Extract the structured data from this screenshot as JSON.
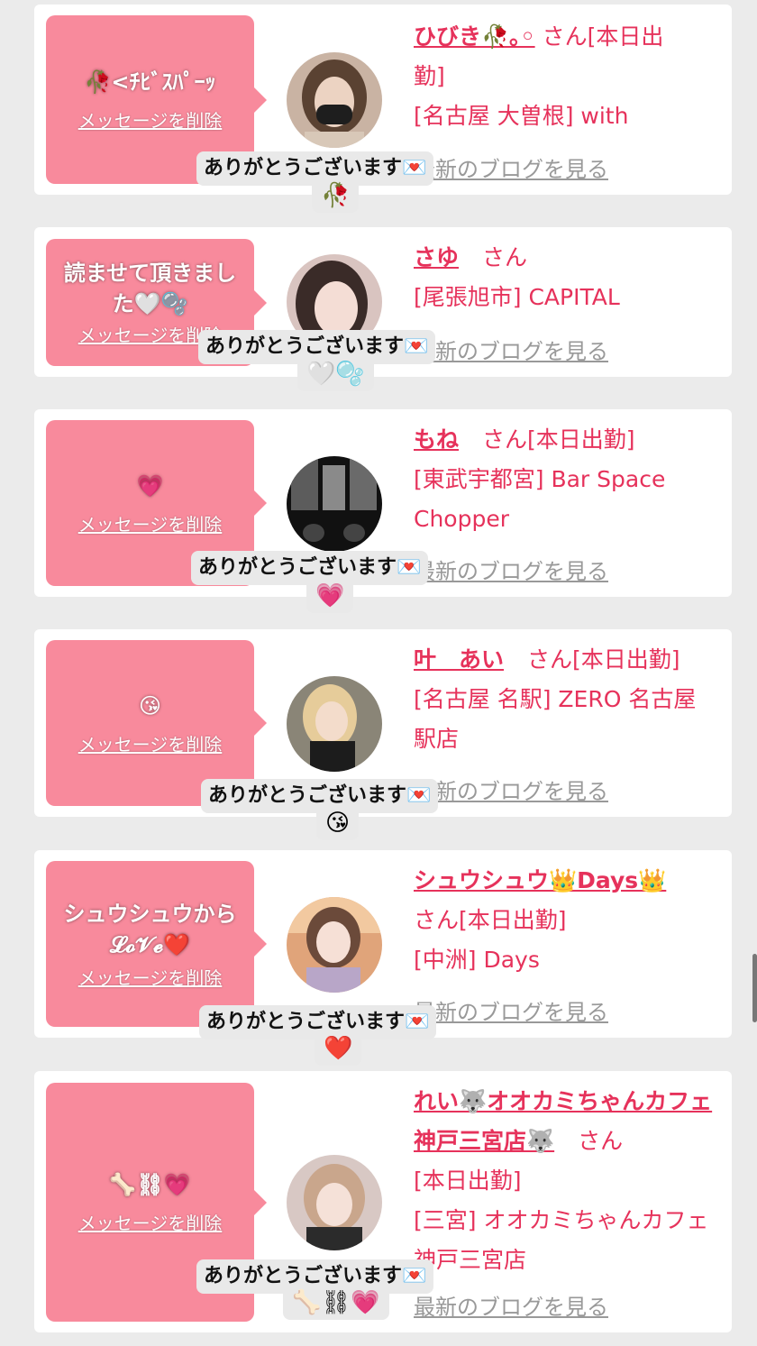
{
  "cards": [
    {
      "message": "🥀<ﾁﾋﾞｽﾊﾟｰｯ",
      "delete_label": "メッセージを削除",
      "name": "ひびき🥀｡◦",
      "san": "さん",
      "lines": [
        "[本日出",
        "勤]",
        "[名古屋 大曽根] with"
      ],
      "blog": "最新のブログを見る",
      "tooltip": "ありがとうございます💌",
      "tooltip_emoji": "🥀"
    },
    {
      "message": "読ませて頂きました🤍🫧",
      "delete_label": "メッセージを削除",
      "name": "さゆ",
      "san": "さん",
      "lines": [
        "[尾張旭市] CAPITAL"
      ],
      "blog": "最新のブログを見る",
      "tooltip": "ありがとうございます💌",
      "tooltip_emoji": "🤍🫧"
    },
    {
      "message": "💗",
      "delete_label": "メッセージを削除",
      "name": "もね",
      "san": "さん[本日出勤]",
      "lines": [
        "[東武宇都宮] Bar Space",
        "Chopper"
      ],
      "blog": "最新のブログを見る",
      "tooltip": "ありがとうございます💌",
      "tooltip_emoji": "💗"
    },
    {
      "message": "😘",
      "delete_label": "メッセージを削除",
      "name": "叶　あい",
      "san": "さん[本日出勤]",
      "lines": [
        "[名古屋 名駅] ZERO 名古屋",
        "駅店"
      ],
      "blog": "最新のブログを見る",
      "tooltip": "ありがとうございます💌",
      "tooltip_emoji": "😘"
    },
    {
      "message": "シュウシュウから𝓛𝓸𝓥𝓮❤️",
      "delete_label": "メッセージを削除",
      "name": "シュウシュウ👑Days👑",
      "san": "さん[本日出勤]",
      "lines": [
        "[中洲] Days"
      ],
      "blog": "最新のブログを見る",
      "tooltip": "ありがとうございます💌",
      "tooltip_emoji": "❤️"
    },
    {
      "message": "🦴⛓💗",
      "delete_label": "メッセージを削除",
      "name": "れい🐺オオカミちゃんカフェ神戸三宮店🐺",
      "san": "さん",
      "lines": [
        "[本日出勤]",
        "[三宮] オオカミちゃんカフェ神戸三宮店"
      ],
      "blog": "最新のブログを見る",
      "tooltip": "ありがとうございます💌",
      "tooltip_emoji": "🦴⛓💗"
    }
  ]
}
